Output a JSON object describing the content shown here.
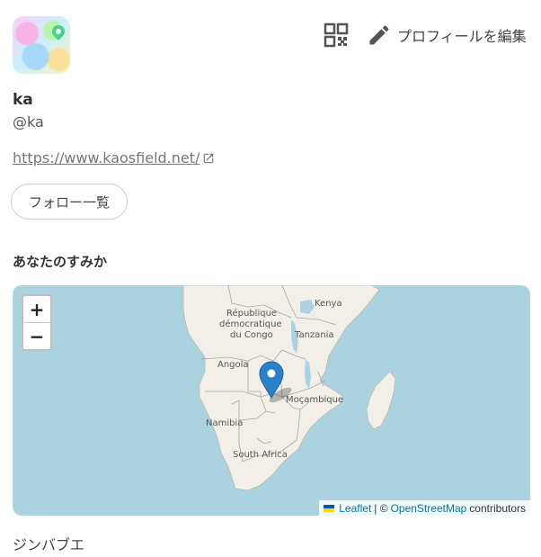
{
  "profile": {
    "name": "ka",
    "handle": "@ka",
    "website": "https://www.kaosfield.net/",
    "follow_list_label": "フォロー一覧"
  },
  "toolbar": {
    "edit_label": "プロフィールを編集"
  },
  "location": {
    "section_title": "あなたのすみか",
    "place_name": "ジンバブエ"
  },
  "map": {
    "zoom_in": "+",
    "zoom_out": "−",
    "labels": {
      "kenya": "Kenya",
      "drc_1": "République",
      "drc_2": "démocratique",
      "drc_3": "du Congo",
      "tanzania": "Tanzania",
      "angola": "Angola",
      "mozambique": "Moçambique",
      "namibia": "Namibia",
      "south_africa": "South Africa"
    },
    "attribution": {
      "leaflet": "Leaflet",
      "separator": "| ©",
      "osm": "OpenStreetMap",
      "contributors": "contributors"
    },
    "colors": {
      "water": "#aad3df",
      "land": "#f2efe9",
      "border": "#9e9e9e",
      "marker": "#2a81cb"
    }
  },
  "icons": {
    "qr": "qr-code-icon",
    "edit": "pencil-icon",
    "external": "external-link-icon",
    "marker": "map-marker-icon"
  }
}
